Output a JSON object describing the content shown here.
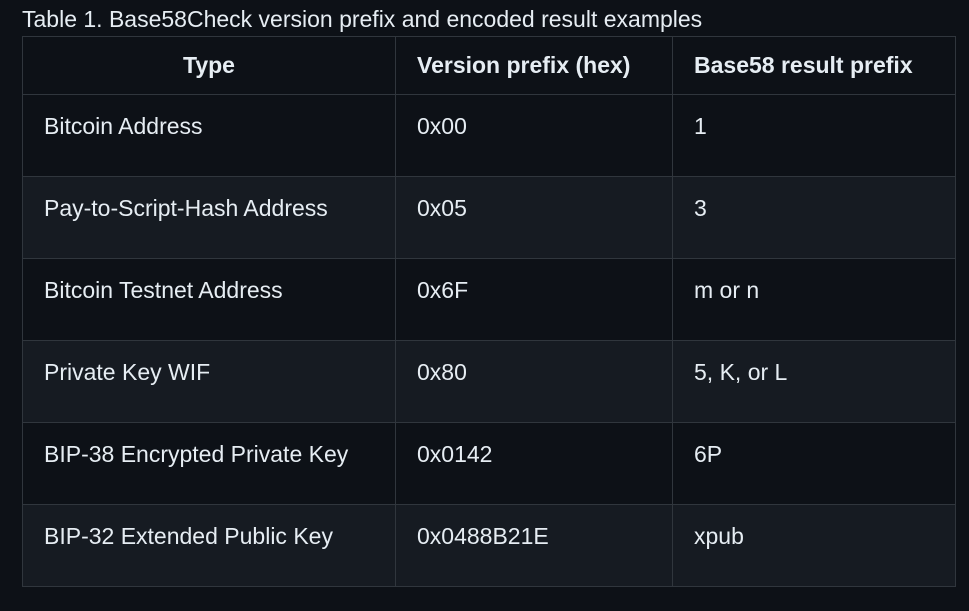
{
  "caption": "Table 1. Base58Check version prefix and encoded result examples",
  "table": {
    "headers": [
      "Type",
      "Version prefix (hex)",
      "Base58 result prefix"
    ],
    "rows": [
      [
        "Bitcoin Address",
        "0x00",
        "1"
      ],
      [
        "Pay-to-Script-Hash Address",
        "0x05",
        "3"
      ],
      [
        "Bitcoin Testnet Address",
        "0x6F",
        "m or n"
      ],
      [
        "Private Key WIF",
        "0x80",
        "5, K, or L"
      ],
      [
        "BIP-38 Encrypted Private Key",
        "0x0142",
        "6P"
      ],
      [
        "BIP-32 Extended Public Key",
        "0x0488B21E",
        "xpub"
      ]
    ]
  },
  "colors": {
    "background": "#0d1117",
    "row_alt": "#161b22",
    "border": "#30363d",
    "text": "#e6edf3"
  }
}
